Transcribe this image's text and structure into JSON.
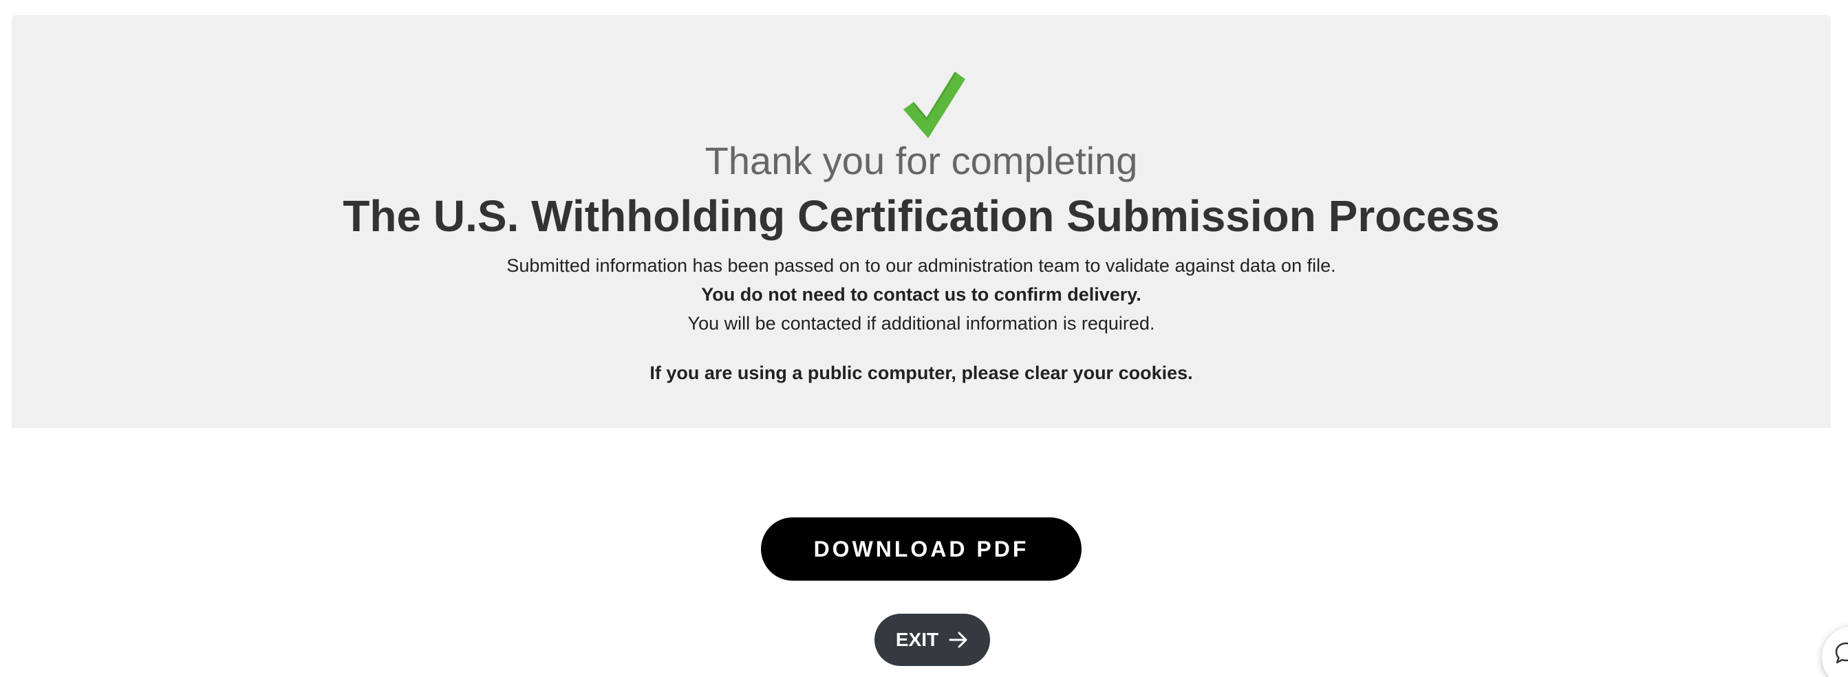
{
  "confirmation": {
    "icon": "checkmark-icon",
    "subtitle": "Thank you for completing",
    "title": "The U.S. Withholding Certification Submission Process",
    "message_1": "Submitted information has been passed on to our administration team to validate against data on file.",
    "message_2": "You do not need to contact us to confirm delivery.",
    "message_3": "You will be contacted if additional information is required.",
    "message_4": "If you are using a public computer, please clear your cookies."
  },
  "actions": {
    "download_label": "DOWNLOAD PDF",
    "exit_label": "EXIT",
    "exit_icon": "arrow-right-icon"
  },
  "chat": {
    "icon": "chat-bubble-icon"
  },
  "colors": {
    "panel_background": "#f0f0f0",
    "check_green": "#5cb83c",
    "download_button": "#000000",
    "exit_button": "#343a40"
  }
}
